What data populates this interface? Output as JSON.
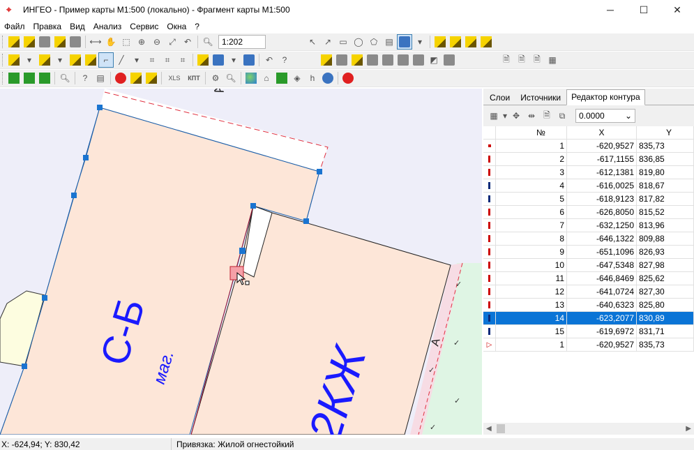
{
  "window": {
    "title": "ИНГЕО - Пример карты М1:500 (локально) - Фрагмент карты М1:500",
    "min": "─",
    "max": "☐",
    "close": "✕"
  },
  "menu": [
    "Файл",
    "Правка",
    "Вид",
    "Анализ",
    "Сервис",
    "Окна",
    "?"
  ],
  "toolbar": {
    "scale_value": "1:202",
    "xls_label": "XLS",
    "kpt_label": "КПТ"
  },
  "map": {
    "label_sb": "С-Б",
    "label_mag": "маг.",
    "label_2kzh": "2КЖ",
    "label_a_top": "А",
    "label_a_right": "А",
    "veg_symbol": "✓"
  },
  "panel": {
    "tabs": [
      "Слои",
      "Источники",
      "Редактор контура"
    ],
    "active_tab": 2,
    "combo_value": "0.0000",
    "columns": [
      "№",
      "X",
      "Y"
    ],
    "rows": [
      {
        "n": "1",
        "x": "-620,9527",
        "y": "835,73"
      },
      {
        "n": "2",
        "x": "-617,1155",
        "y": "836,85"
      },
      {
        "n": "3",
        "x": "-612,1381",
        "y": "819,80"
      },
      {
        "n": "4",
        "x": "-616,0025",
        "y": "818,67"
      },
      {
        "n": "5",
        "x": "-618,9123",
        "y": "817,82"
      },
      {
        "n": "6",
        "x": "-626,8050",
        "y": "815,52"
      },
      {
        "n": "7",
        "x": "-632,1250",
        "y": "813,96"
      },
      {
        "n": "8",
        "x": "-646,1322",
        "y": "809,88"
      },
      {
        "n": "9",
        "x": "-651,1096",
        "y": "826,93"
      },
      {
        "n": "10",
        "x": "-647,5348",
        "y": "827,98"
      },
      {
        "n": "11",
        "x": "-646,8469",
        "y": "825,62"
      },
      {
        "n": "12",
        "x": "-641,0724",
        "y": "827,30"
      },
      {
        "n": "13",
        "x": "-640,6323",
        "y": "825,80"
      },
      {
        "n": "14",
        "x": "-623,2077",
        "y": "830,89"
      },
      {
        "n": "15",
        "x": "-619,6972",
        "y": "831,71"
      },
      {
        "n": "1",
        "x": "-620,9527",
        "y": "835,73"
      }
    ],
    "selected_row": 13
  },
  "status": {
    "coords": "X: -624,94; Y: 830,42",
    "snap": "Привязка: Жилой огнестойкий"
  },
  "colors": {
    "selection": "#0a74d6",
    "building_fill": "#fde6d8",
    "map_bg": "#eeeef9",
    "vegetation": "#dff5e4",
    "label_blue": "#1a1aff"
  }
}
